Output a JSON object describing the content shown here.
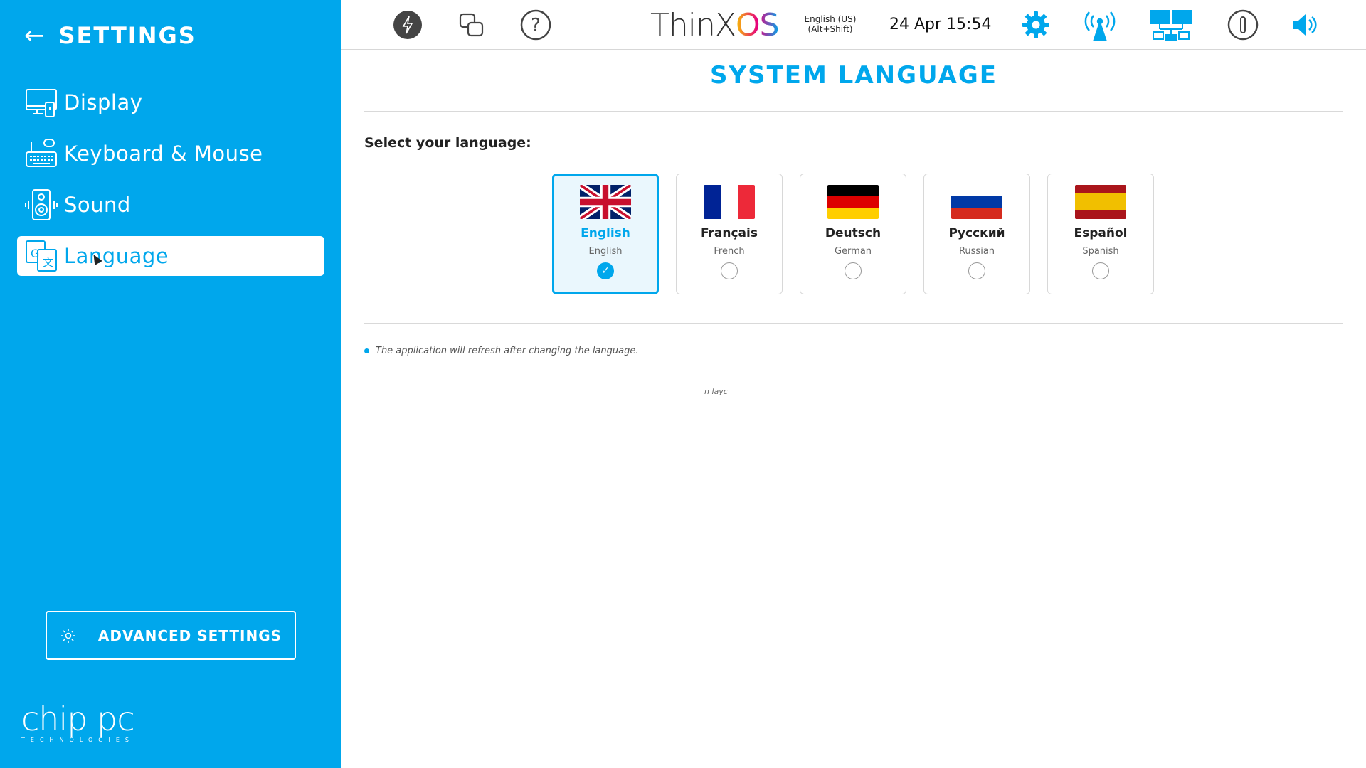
{
  "sidebar": {
    "title": "SETTINGS",
    "back_icon": "arrow-left-icon",
    "items": [
      {
        "label": "Display",
        "icon": "display-icon",
        "active": false
      },
      {
        "label": "Keyboard & Mouse",
        "icon": "keyboard-mouse-icon",
        "active": false
      },
      {
        "label": "Sound",
        "icon": "speaker-icon",
        "active": false
      },
      {
        "label": "Language",
        "icon": "translate-icon",
        "active": true
      }
    ],
    "advanced_label": "ADVANCED SETTINGS",
    "brand": "chip pc",
    "brand_sub": "TECHNOLOGIES"
  },
  "topbar": {
    "icons": [
      "power-icon",
      "windows-icon",
      "help-icon",
      "settings-icon",
      "wireless-icon",
      "network-icon",
      "info-icon",
      "volume-icon"
    ],
    "logo_text": "ThinX",
    "logo_accent": "OS",
    "keyboard_layout_line1": "English (US)",
    "keyboard_layout_line2": "(Alt+Shift)",
    "datetime": "24 Apr 15:54"
  },
  "main": {
    "title": "SYSTEM LANGUAGE",
    "select_label": "Select your language:",
    "languages": [
      {
        "name": "English",
        "sub": "English",
        "flag": "uk-flag-icon",
        "selected": true
      },
      {
        "name": "Français",
        "sub": "French",
        "flag": "france-flag-icon",
        "selected": false
      },
      {
        "name": "Deutsch",
        "sub": "German",
        "flag": "germany-flag-icon",
        "selected": false
      },
      {
        "name": "Русский",
        "sub": "Russian",
        "flag": "russia-flag-icon",
        "selected": false
      },
      {
        "name": "Español",
        "sub": "Spanish",
        "flag": "spain-flag-icon",
        "selected": false
      }
    ],
    "note": "The application will refresh after changing the language.",
    "fragment": "n layc"
  },
  "colors": {
    "accent": "#00a7ec",
    "sidebar_bg": "#00a7ec"
  }
}
